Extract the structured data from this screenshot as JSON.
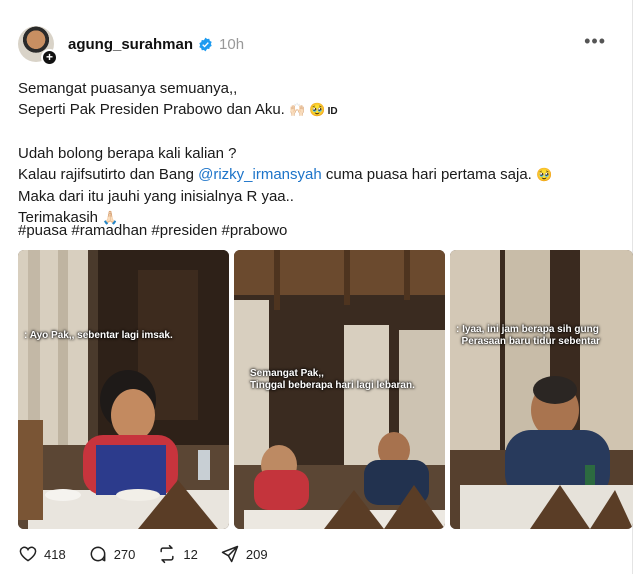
{
  "post": {
    "username": "agung_surahman",
    "time": "10h",
    "more": "•••",
    "lines": [
      "Semangat puasanya semuanya,,",
      "Seperti Pak Presiden Prabowo dan Aku.",
      "Udah bolong berapa kali kalian ?",
      "Kalau rajifsutirto dan Bang ",
      "@rizky_irmansyah",
      " cuma puasa hari pertama saja.",
      "Maka dari itu jauhi yang inisialnya R yaa..",
      "Terimakasih"
    ],
    "id_tag": "ID",
    "hashtags": "#puasa #ramadhan #presiden #prabowo"
  },
  "media": {
    "captions": [
      ": Ayo Pak,, sebentar lagi imsak.",
      "Semangat Pak,,\nTinggal beberapa hari lagi lebaran.",
      ": Iyaa, ini jam berapa sih gung\n  Perasaan baru tidur sebentar"
    ]
  },
  "actions": {
    "likes": "418",
    "replies": "270",
    "reposts": "12",
    "shares": "209"
  },
  "colors": {
    "mention": "#1d74c9",
    "verified": "#1d9bf0",
    "muted": "#999999"
  }
}
